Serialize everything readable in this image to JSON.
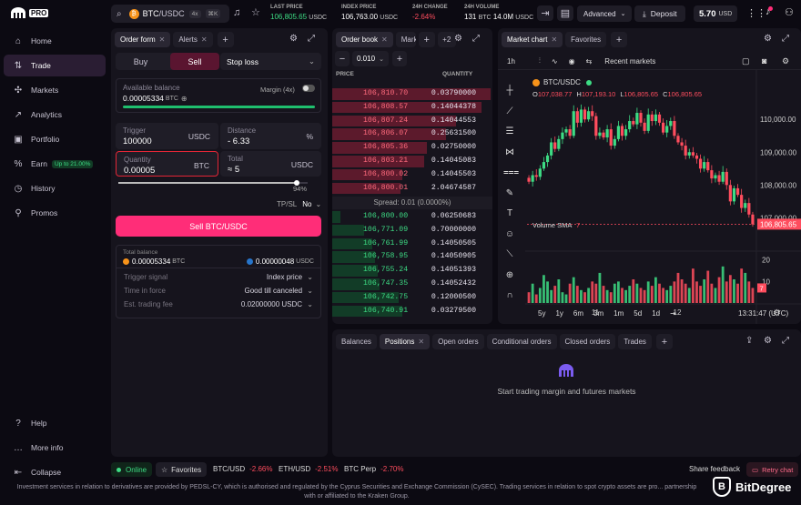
{
  "app": {
    "logo_text": "PRO"
  },
  "sidebar": {
    "items": [
      {
        "label": "Home",
        "icon": "home-icon"
      },
      {
        "label": "Trade",
        "icon": "trade-icon"
      },
      {
        "label": "Markets",
        "icon": "markets-icon"
      },
      {
        "label": "Analytics",
        "icon": "analytics-icon"
      },
      {
        "label": "Portfolio",
        "icon": "portfolio-icon"
      },
      {
        "label": "Earn",
        "icon": "earn-icon",
        "badge": "Up to 21.00%"
      },
      {
        "label": "History",
        "icon": "history-icon"
      },
      {
        "label": "Promos",
        "icon": "promos-icon"
      }
    ],
    "bottom": [
      {
        "label": "Help"
      },
      {
        "label": "More info"
      },
      {
        "label": "Collapse"
      }
    ]
  },
  "topbar": {
    "pair": "BTC",
    "quote": "/USDC",
    "leverage": "4x",
    "shortcut": "⌘K",
    "stats": [
      {
        "label": "LAST PRICE",
        "value": "106,805.65",
        "unit": "USDC",
        "color": "#3ddc84"
      },
      {
        "label": "INDEX PRICE",
        "value": "106,763.00",
        "unit": "USDC",
        "color": "#ffffff"
      },
      {
        "label": "24H CHANGE",
        "value": "-2.64%",
        "unit": "",
        "color": "#ff4d5e"
      },
      {
        "label": "24H VOLUME",
        "value": "131",
        "unit": "BTC",
        "value2": "14.0M",
        "unit2": "USDC",
        "color": "#ffffff"
      }
    ],
    "mode": "Advanced",
    "deposit": "Deposit",
    "balance": "5.70",
    "balance_unit": "USD"
  },
  "order_form": {
    "tabs": [
      "Order form",
      "Alerts"
    ],
    "buy": "Buy",
    "sell": "Sell",
    "type": "Stop loss",
    "available_label": "Available balance",
    "available_value": "0.00005334",
    "available_unit": "BTC",
    "margin_label": "Margin (4x)",
    "trigger_label": "Trigger",
    "trigger_value": "100000",
    "trigger_unit": "USDC",
    "distance_label": "Distance",
    "distance_value": "- 6.33",
    "distance_unit": "%",
    "quantity_label": "Quantity",
    "quantity_value": "0.00005",
    "quantity_unit": "BTC",
    "total_label": "Total",
    "total_value": "≈ 5",
    "total_unit": "USDC",
    "slider_pct": "94%",
    "slider_fraction": 0.94,
    "tpsl_label": "TP/SL",
    "tpsl_value": "No",
    "submit": "Sell BTC/USDC",
    "total_balance_label": "Total balance",
    "tb_btc": "0.00005334",
    "tb_btc_unit": "BTC",
    "tb_usdc": "0.00000048",
    "tb_usdc_unit": "USDC",
    "trigger_signal_label": "Trigger signal",
    "trigger_signal_value": "Index price",
    "tif_label": "Time in force",
    "tif_value": "Good till canceled",
    "fee_label": "Est. trading fee",
    "fee_value": "0.02000000 USDC"
  },
  "orderbook": {
    "tabs": [
      "Order book",
      "Mark"
    ],
    "more": "+2",
    "tick": "0.010",
    "col_price": "PRICE",
    "col_qty": "QUANTITY",
    "asks": [
      {
        "p": "106,810.70",
        "q": "0.03790000",
        "d": 1.0
      },
      {
        "p": "106,808.57",
        "q": "0.14044378",
        "d": 0.94
      },
      {
        "p": "106,807.24",
        "q": "0.14044553",
        "d": 0.78
      },
      {
        "p": "106,806.07",
        "q": "0.25631500",
        "d": 0.72
      },
      {
        "p": "106,805.36",
        "q": "0.02750000",
        "d": 0.6
      },
      {
        "p": "106,803.21",
        "q": "0.14045083",
        "d": 0.58
      },
      {
        "p": "106,800.02",
        "q": "0.14045503",
        "d": 0.44
      },
      {
        "p": "106,800.01",
        "q": "2.04674587",
        "d": 0.43
      }
    ],
    "spread": "Spread: 0.01 (0.0000%)",
    "bids": [
      {
        "p": "106,800.00",
        "q": "0.06250683",
        "d": 0.05
      },
      {
        "p": "106,771.09",
        "q": "0.70000000",
        "d": 0.2
      },
      {
        "p": "106,761.99",
        "q": "0.14050505",
        "d": 0.25
      },
      {
        "p": "106,758.95",
        "q": "0.14050905",
        "d": 0.27
      },
      {
        "p": "106,755.24",
        "q": "0.14051393",
        "d": 0.29
      },
      {
        "p": "106,747.35",
        "q": "0.14052432",
        "d": 0.3
      },
      {
        "p": "106,742.75",
        "q": "0.12000500",
        "d": 0.42
      },
      {
        "p": "106,740.91",
        "q": "0.03279500",
        "d": 0.44
      }
    ]
  },
  "chart": {
    "tabs": [
      "Market chart",
      "Favorites"
    ],
    "interval": "1h",
    "recent_markets": "Recent markets",
    "symbol": "BTC/USDC",
    "ohlc": {
      "o_label": "O",
      "o": "107,038.77",
      "h_label": "H",
      "h": "107,193.10",
      "l_label": "L",
      "l": "106,805.65",
      "c_label": "C",
      "c": "106,805.65"
    },
    "y_ticks": [
      "110,000.00",
      "109,000.00",
      "108,000.00",
      "107,000.00"
    ],
    "last_price_tag": "106,805.65",
    "volume_label": "Volume SMA",
    "volume_value": "7",
    "vol_ticks": [
      "20",
      "10"
    ],
    "vol_tag": "7",
    "x_ticks": [
      "11",
      "12"
    ],
    "ranges": [
      "5y",
      "1y",
      "6m",
      "3m",
      "1m",
      "5d",
      "1d"
    ],
    "time": "13:31:47 (UTC)",
    "candles": [
      108100,
      108300,
      108250,
      108500,
      108700,
      108900,
      109300,
      109100,
      109400,
      109600,
      109700,
      109500,
      110250,
      109900,
      110300,
      110000,
      110250,
      110100,
      109500,
      109600,
      109450,
      109700,
      109200,
      109400,
      109800,
      109500,
      109700,
      109950,
      109850,
      110200,
      109900,
      109650,
      110150,
      109950,
      110150,
      109900,
      109600,
      109800,
      109950,
      109500,
      109300,
      109200,
      108900,
      109000,
      108900,
      108800,
      108500,
      108700,
      108450,
      108200,
      108300,
      108100,
      108400,
      108000,
      107500,
      107900,
      107700,
      107300,
      107450,
      107100,
      106800
    ],
    "volumes": [
      5,
      9,
      4,
      7,
      13,
      10,
      6,
      8,
      11,
      5,
      4,
      9,
      12,
      8,
      6,
      5,
      7,
      10,
      9,
      14,
      8,
      6,
      5,
      9,
      10,
      7,
      6,
      8,
      11,
      9,
      7,
      6,
      10,
      8,
      12,
      9,
      7,
      6,
      8,
      10,
      14,
      11,
      9,
      7,
      16,
      10,
      8,
      11,
      15,
      9,
      7,
      12,
      17,
      10,
      13,
      11,
      9,
      16,
      14,
      10,
      7
    ]
  },
  "bottom_panel": {
    "tabs": [
      "Balances",
      "Positions",
      "Open orders",
      "Conditional orders",
      "Closed orders",
      "Trades"
    ],
    "empty_text": "Start trading margin and futures markets"
  },
  "statusbar": {
    "online": "Online",
    "favorites": "Favorites",
    "tickers": [
      {
        "sym": "BTC/USD",
        "chg": "-2.66%"
      },
      {
        "sym": "ETH/USD",
        "chg": "-2.51%"
      },
      {
        "sym": "BTC Perp",
        "chg": "-2.70%"
      }
    ],
    "share": "Share feedback",
    "retry": "Retry chat"
  },
  "disclaimer": "Investment services in relation to derivatives are provided by PEDSL-CY, which is authorised and regulated by the Cyprus Securities and Exchange Commission (CySEC). Trading services in relation to spot crypto assets are pro... partnership with or affiliated to the Kraken Group.",
  "watermark": "BitDegree",
  "colors": {
    "accent": "#ff2d78",
    "buy": "#3ddc84",
    "sell": "#ff4d5e",
    "bg": "#0c0a12",
    "panel": "#16141d"
  }
}
